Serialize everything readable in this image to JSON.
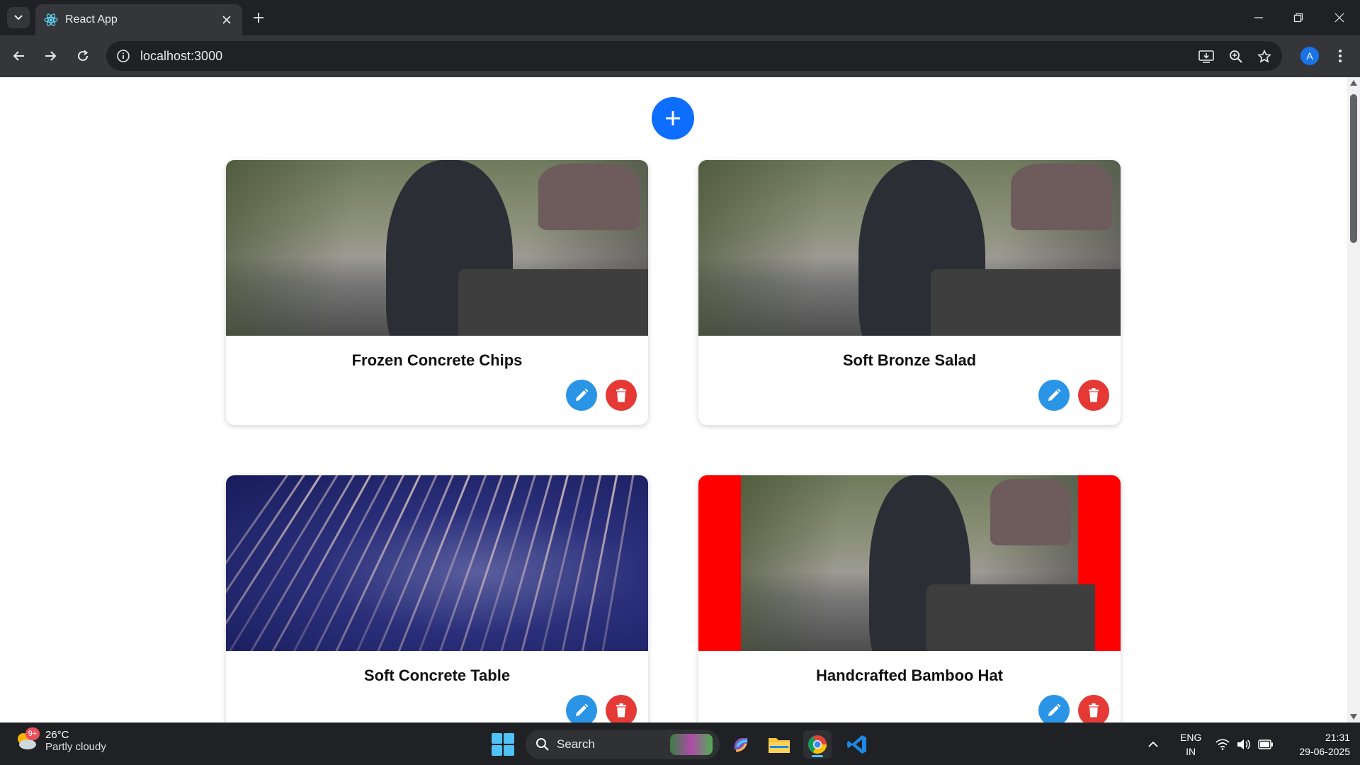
{
  "browser": {
    "tab_title": "React App",
    "url": "localhost:3000",
    "profile_initial": "A"
  },
  "page": {
    "add_button_label": "+",
    "cards": [
      {
        "title": "Frozen Concrete Chips",
        "image": "bronze-cat-statue",
        "edit_icon": "pencil-icon",
        "delete_icon": "trash-icon"
      },
      {
        "title": "Soft Bronze Salad",
        "image": "bronze-cat-statue",
        "edit_icon": "pencil-icon",
        "delete_icon": "trash-icon"
      },
      {
        "title": "Soft Concrete Table",
        "image": "fireworks",
        "edit_icon": "pencil-icon",
        "delete_icon": "trash-icon"
      },
      {
        "title": "Handcrafted Bamboo Hat",
        "image": "bronze-cat-statue-red-border",
        "edit_icon": "pencil-icon",
        "delete_icon": "trash-icon"
      }
    ]
  },
  "taskbar": {
    "weather_badge": "9+",
    "weather_temp": "26°C",
    "weather_condition": "Partly cloudy",
    "search_label": "Search",
    "language_line1": "ENG",
    "language_line2": "IN",
    "time": "21:31",
    "date": "29-06-2025"
  },
  "colors": {
    "add_button": "#0d6efd",
    "edit_button": "#2a94e6",
    "delete_button": "#e53935",
    "red_frame": "#ff0000"
  }
}
